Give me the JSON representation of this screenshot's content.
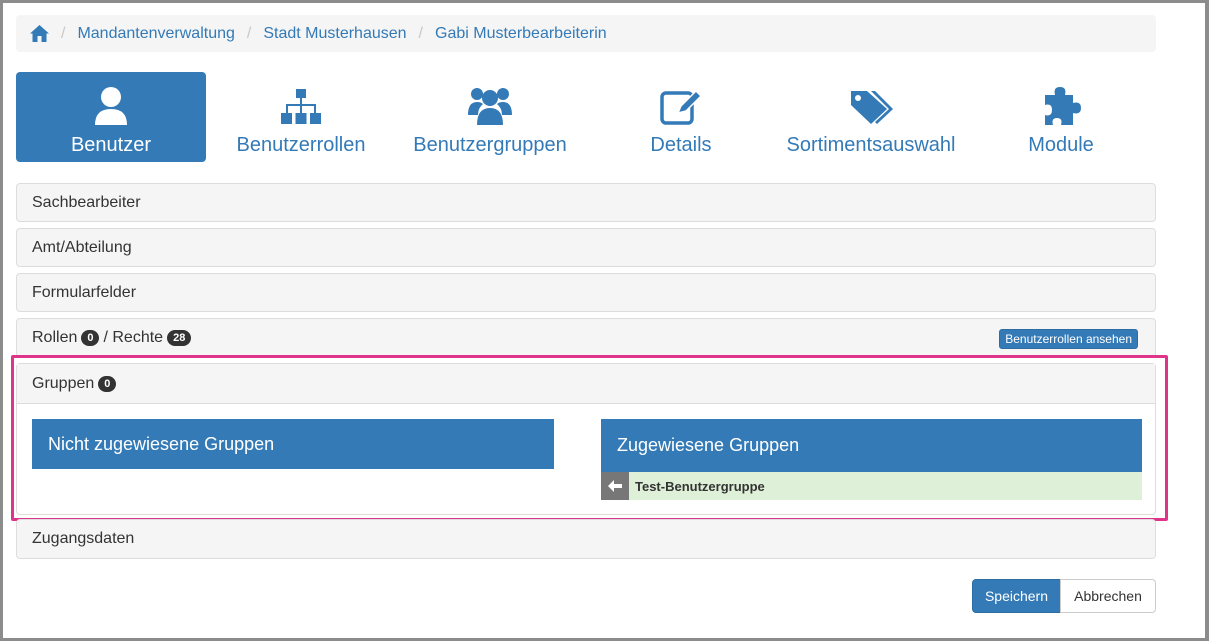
{
  "breadcrumb": {
    "items": [
      "Mandantenverwaltung",
      "Stadt Musterhausen",
      "Gabi Musterbearbeiterin"
    ]
  },
  "tabs": [
    {
      "label": "Benutzer",
      "icon": "user-icon",
      "active": true
    },
    {
      "label": "Benutzerrollen",
      "icon": "sitemap-icon",
      "active": false
    },
    {
      "label": "Benutzergruppen",
      "icon": "users-icon",
      "active": false
    },
    {
      "label": "Details",
      "icon": "edit-icon",
      "active": false
    },
    {
      "label": "Sortimentsauswahl",
      "icon": "tags-icon",
      "active": false
    },
    {
      "label": "Module",
      "icon": "puzzle-icon",
      "active": false
    }
  ],
  "panels": {
    "sachbearbeiter": "Sachbearbeiter",
    "amt": "Amt/Abteilung",
    "formular": "Formularfelder",
    "rollen_label": "Rollen",
    "rollen_count": "0",
    "rechte_label": "/ Rechte",
    "rechte_count": "28",
    "rollen_button": "Benutzerrollen ansehen",
    "gruppen_label": "Gruppen",
    "gruppen_count": "0",
    "zugang": "Zugangsdaten"
  },
  "groups": {
    "unassigned_title": "Nicht zugewiesene Gruppen",
    "assigned_title": "Zugewiesene Gruppen",
    "assigned_items": [
      "Test-Benutzergruppe"
    ]
  },
  "actions": {
    "save": "Speichern",
    "cancel": "Abbrechen"
  },
  "colors": {
    "primary": "#337ab7",
    "highlight": "#e0338a",
    "assigned_row": "#dff0d8"
  }
}
